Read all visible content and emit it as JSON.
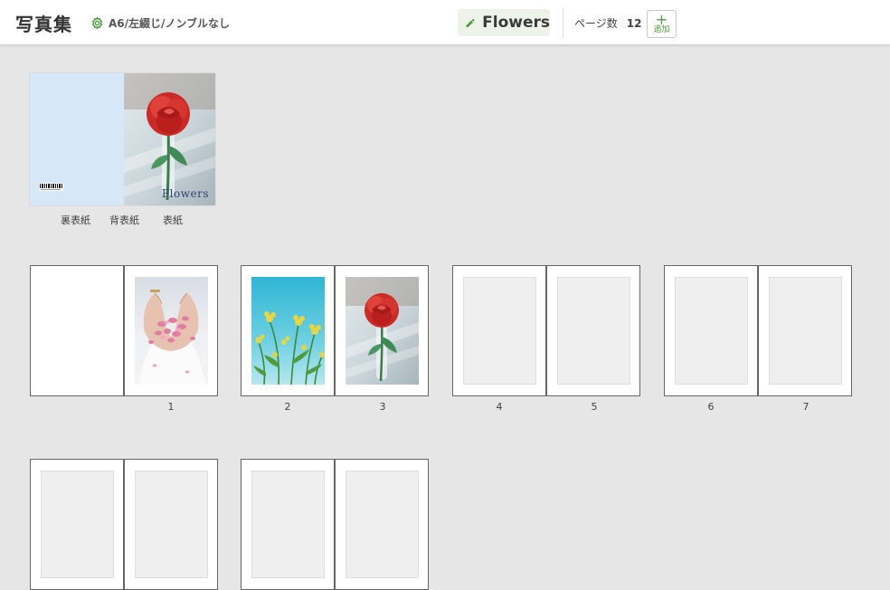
{
  "header": {
    "title": "写真集",
    "settings_label": "A6/左綴じ/ノンブルなし",
    "book_title": "Flowers",
    "page_count_label": "ページ数",
    "page_count": "12",
    "add_label": "追加",
    "add_symbol": "+"
  },
  "cover": {
    "title_text": "Flowers",
    "labels": [
      "裏表紙",
      "背表紙",
      "表紙"
    ]
  },
  "pages": {
    "numbers": [
      "1",
      "2",
      "3",
      "4",
      "5",
      "6",
      "7"
    ]
  },
  "colors": {
    "accent": "#4e9a3e",
    "canvas": "#e6e6e6",
    "back_cover": "#d6e8f8"
  }
}
